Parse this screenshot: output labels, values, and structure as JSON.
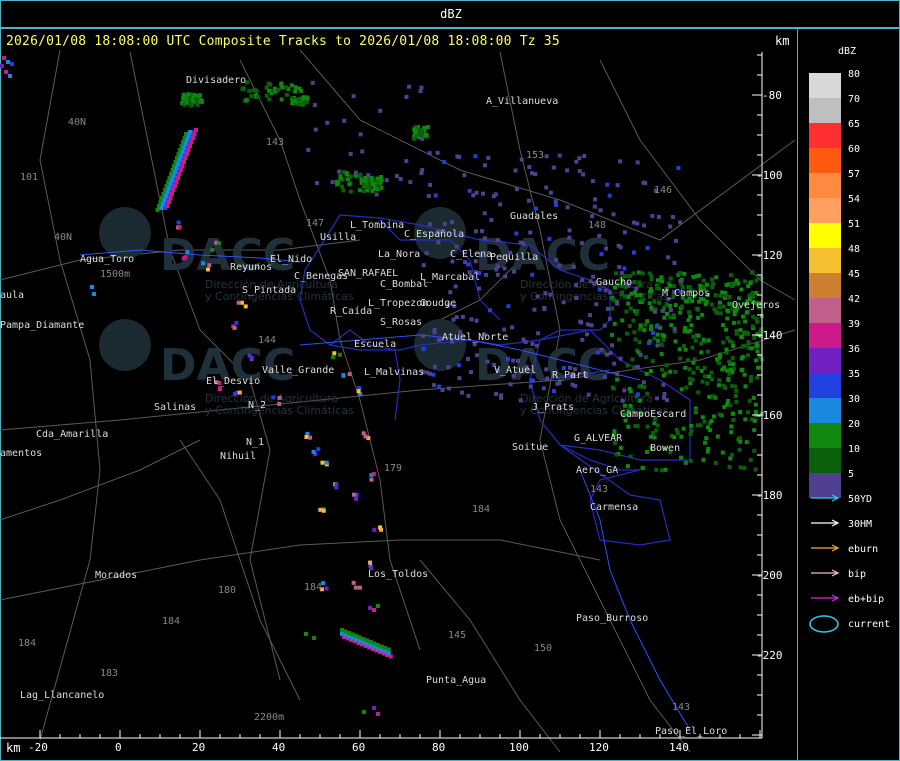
{
  "header": {
    "unit_title": "dBZ",
    "composite_line": "2026/01/08 18:08:00 UTC Composite Tracks to 2026/01/08 18:08:00 Tz 35",
    "km_top": "km",
    "km_bottom": "km"
  },
  "legend": {
    "title": "dBZ",
    "levels": [
      {
        "value": "80",
        "color": "#d8d8d8"
      },
      {
        "value": "70",
        "color": "#bfbfbf"
      },
      {
        "value": "65",
        "color": "#ff3030"
      },
      {
        "value": "60",
        "color": "#ff5a10"
      },
      {
        "value": "57",
        "color": "#ff8a40"
      },
      {
        "value": "54",
        "color": "#ffa060"
      },
      {
        "value": "51",
        "color": "#ffff00"
      },
      {
        "value": "48",
        "color": "#f4c030"
      },
      {
        "value": "45",
        "color": "#cc8030"
      },
      {
        "value": "42",
        "color": "#c0608a"
      },
      {
        "value": "39",
        "color": "#cc1a8a"
      },
      {
        "value": "36",
        "color": "#7020c0"
      },
      {
        "value": "35",
        "color": "#2040e0"
      },
      {
        "value": "30",
        "color": "#1888e0"
      },
      {
        "value": "20",
        "color": "#108810"
      },
      {
        "value": "10",
        "color": "#0a600a"
      },
      {
        "value": "5",
        "color": "#504090"
      }
    ],
    "tracks": [
      {
        "label": "50YD",
        "color": "#30d0e0"
      },
      {
        "label": "30HM",
        "color": "#ffffff"
      },
      {
        "label": "eburn",
        "color": "#f0b030"
      },
      {
        "label": "bip",
        "color": "#f0c0c0"
      },
      {
        "label": "eb+bip",
        "color": "#e020e0"
      }
    ],
    "current_label": "current",
    "current_color": "#30d0e0"
  },
  "axes": {
    "x_ticks": [
      "-20",
      "0",
      "20",
      "40",
      "60",
      "80",
      "100",
      "120",
      "140"
    ],
    "y_ticks": [
      "-80",
      "-100",
      "-120",
      "-140",
      "-160",
      "-180",
      "-200",
      "-220"
    ]
  },
  "places": [
    {
      "name": "Divisadero"
    },
    {
      "name": "A_Villanueva"
    },
    {
      "name": "Guadales"
    },
    {
      "name": "L_Tombina"
    },
    {
      "name": "Usilla"
    },
    {
      "name": "C_Española"
    },
    {
      "name": "La_Nora"
    },
    {
      "name": "C_Elena"
    },
    {
      "name": "Pequilla"
    },
    {
      "name": "Gaucho"
    },
    {
      "name": "C_Benegas"
    },
    {
      "name": "SAN_RAFAEL"
    },
    {
      "name": "L_Marcabal"
    },
    {
      "name": "C_Bombal"
    },
    {
      "name": "S_Pintada"
    },
    {
      "name": "L_Tropezon"
    },
    {
      "name": "Goudge"
    },
    {
      "name": "R_Caída"
    },
    {
      "name": "S_Rosas"
    },
    {
      "name": "Atuel_Norte"
    },
    {
      "name": "Escuela"
    },
    {
      "name": "Valle_Grande"
    },
    {
      "name": "L_Malvinas"
    },
    {
      "name": "V_Atuel"
    },
    {
      "name": "R_Part"
    },
    {
      "name": "El_Desvio"
    },
    {
      "name": "Salinas"
    },
    {
      "name": "J_Prats"
    },
    {
      "name": "CampoEscard"
    },
    {
      "name": "G_ALVEAR"
    },
    {
      "name": "Soitue"
    },
    {
      "name": "Bowen"
    },
    {
      "name": "Aero_GA"
    },
    {
      "name": "Carmensa"
    },
    {
      "name": "Nihuil"
    },
    {
      "name": "Cda_Amarilla"
    },
    {
      "name": "Agua_Toro"
    },
    {
      "name": "Pampa_Diamante"
    },
    {
      "name": "Los_Toldos"
    },
    {
      "name": "Morados"
    },
    {
      "name": "Paso_Burroso"
    },
    {
      "name": "Punta_Agua"
    },
    {
      "name": "Lag_Llancanelo"
    },
    {
      "name": "Paso_El_Loro"
    },
    {
      "name": "M_Campos"
    },
    {
      "name": "Ovejeros"
    },
    {
      "name": "Reyunos"
    },
    {
      "name": "El_Nido"
    },
    {
      "name": "N_1"
    },
    {
      "name": "N_2"
    },
    {
      "name": "aula"
    },
    {
      "name": "amentos"
    }
  ],
  "routes": [
    "143",
    "153",
    "146",
    "148",
    "40N",
    "101",
    "147",
    "144",
    "179",
    "184",
    "183",
    "180",
    "150",
    "145",
    "153",
    "184",
    "143"
  ],
  "watermark": {
    "text": "DACC",
    "sub1": "Dirección de Agricultura",
    "sub2": "y Contingencias Climáticas"
  },
  "elevation_labels": [
    "1500m",
    "2200m"
  ]
}
